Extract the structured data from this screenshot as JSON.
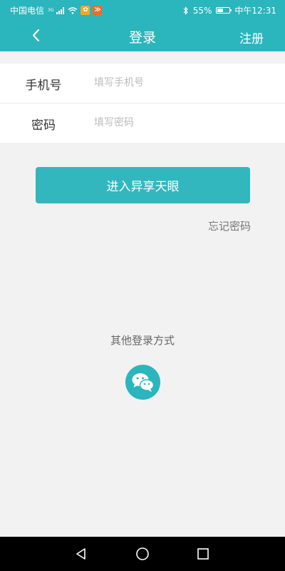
{
  "status_bar": {
    "carrier": "中国电信",
    "network_type": "3G",
    "battery_percent": "55%",
    "battery_level": 0.55,
    "time": "中午12:31",
    "app_badge_1_color": "#f5a623",
    "app_badge_2_color": "#f56a23"
  },
  "app_bar": {
    "title": "登录",
    "register_label": "注册",
    "back_icon": "chevron-left-icon"
  },
  "form": {
    "phone_label": "手机号",
    "phone_placeholder": "填写手机号",
    "phone_value": "",
    "password_label": "密码",
    "password_placeholder": "填写密码",
    "password_value": ""
  },
  "login_button_label": "进入异享天眼",
  "forgot_password_label": "忘记密码",
  "other_login_label": "其他登录方式",
  "colors": {
    "primary": "#2bb5bd",
    "button": "#33b7bf",
    "background": "#f2f2f2"
  }
}
